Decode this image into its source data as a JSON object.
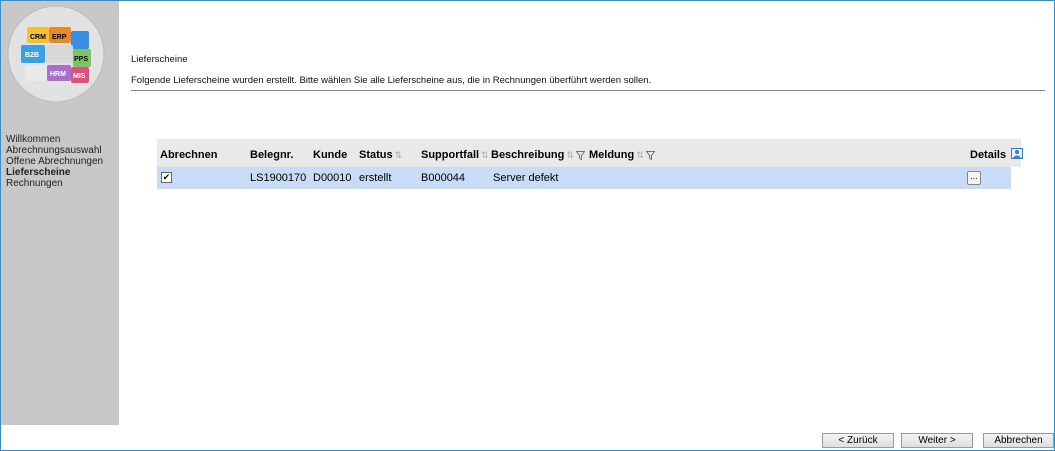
{
  "sidebar": {
    "logo_labels": [
      "CRM",
      "ERP",
      "B2B",
      "PPS",
      "HRM",
      "MIS"
    ],
    "items": [
      {
        "label": "Willkommen",
        "active": false
      },
      {
        "label": "Abrechnungsauswahl",
        "active": false
      },
      {
        "label": "Offene Abrechnungen",
        "active": false
      },
      {
        "label": "Lieferscheine",
        "active": true
      },
      {
        "label": "Rechnungen",
        "active": false
      }
    ]
  },
  "main": {
    "heading": "Lieferscheine",
    "intro": "Folgende Lieferscheine wurden erstellt. Bitte wählen Sie alle Lieferscheine aus, die in Rechnungen überführt werden sollen."
  },
  "table": {
    "headers": {
      "abrechnen": "Abrechnen",
      "belegnr": "Belegnr.",
      "kunde": "Kunde",
      "status": "Status",
      "supportfall": "Supportfall",
      "beschreibung": "Beschreibung",
      "meldung": "Meldung",
      "details": "Details"
    },
    "rows": [
      {
        "checked": true,
        "belegnr": "LS1900170",
        "kunde": "D00010",
        "status": "erstellt",
        "supportfall": "B000044",
        "beschreibung": "Server defekt",
        "meldung": "",
        "details_label": "..."
      }
    ]
  },
  "footer": {
    "back": "< Zurück",
    "next": "Weiter >",
    "cancel": "Abbrechen"
  },
  "colors": {
    "sidebar_bg": "#c8c8c8",
    "header_bg": "#e9e9e9",
    "selected_row_bg": "#c8dcf6",
    "window_border": "#2f8fd8"
  }
}
